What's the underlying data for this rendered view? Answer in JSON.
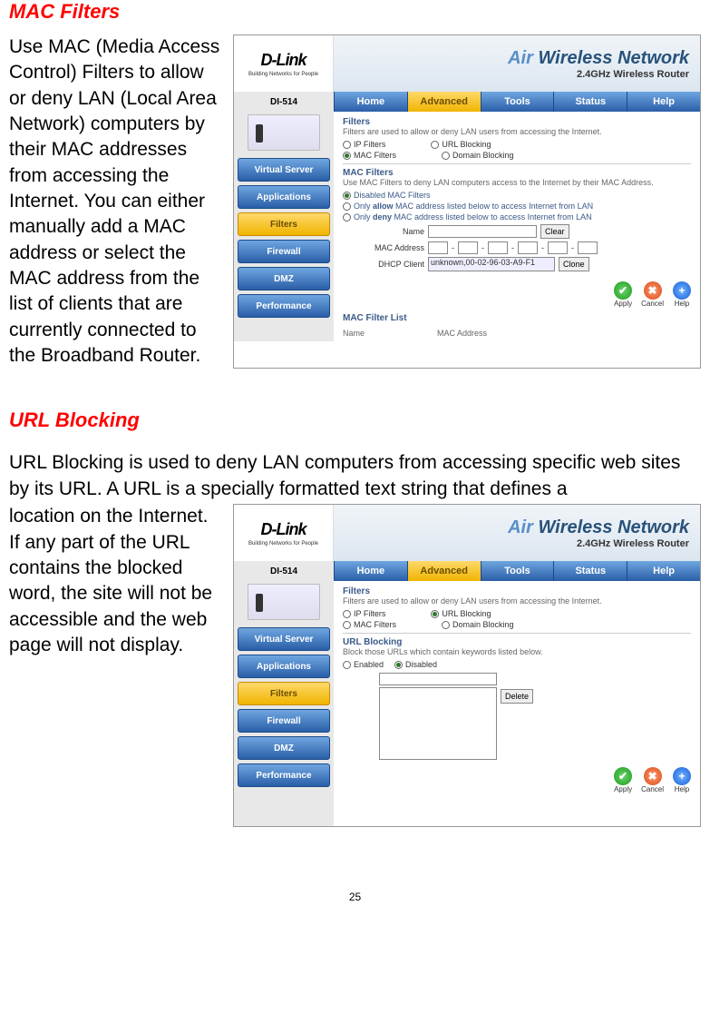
{
  "section1": {
    "heading": "MAC Filters",
    "text": "Use MAC (Media Access Control) Filters to allow or deny LAN (Local Area Network) computers by their MAC addresses from accessing the Internet. You can either manually add a MAC address or select the MAC address from the list of clients that are currently connected to the Broadband Router."
  },
  "section2": {
    "heading": "URL Blocking",
    "intro": "URL Blocking is used to deny LAN computers from accessing specific web sites by its URL. A URL is a specially formatted text string that defines a",
    "text": "location on the Internet. If any part of the URL contains the blocked word, the site will not be accessible and the web page will not display."
  },
  "ui_common": {
    "brand_bold": "D-Link",
    "brand_sub": "Building Networks for People",
    "air": "Air",
    "wireless": " Wireless Network",
    "subbrand": "2.4GHz Wireless Router",
    "model": "DI-514",
    "tabs": {
      "home": "Home",
      "advanced": "Advanced",
      "tools": "Tools",
      "status": "Status",
      "help": "Help"
    },
    "side": {
      "vs": "Virtual Server",
      "app": "Applications",
      "filters": "Filters",
      "firewall": "Firewall",
      "dmz": "DMZ",
      "perf": "Performance"
    },
    "filters_h": "Filters",
    "filters_desc": "Filters are used to allow or deny LAN users from accessing the Internet.",
    "opt_ip": "IP Filters",
    "opt_url": "URL Blocking",
    "opt_mac": "MAC Filters",
    "opt_domain": "Domain Blocking",
    "actions": {
      "apply": "Apply",
      "cancel": "Cancel",
      "help": "Help"
    }
  },
  "mac_pane": {
    "h": "MAC Filters",
    "desc": "Use MAC Filters to deny LAN computers access to the Internet by their MAC Address.",
    "r1": "Disabled MAC Filters",
    "r2_a": "Only ",
    "r2_b": "allow",
    "r2_c": " MAC address listed below to access Internet from LAN",
    "r3_a": "Only ",
    "r3_b": "deny",
    "r3_c": " MAC address listed below to access Internet from LAN",
    "lbl_name": "Name",
    "lbl_mac": "MAC Address",
    "lbl_dhcp": "DHCP Client",
    "dhcp_val": "unknown,00-02-96-03-A9-F1",
    "btn_clear": "Clear",
    "btn_clone": "Clone",
    "list_h": "MAC Filter List",
    "col1": "Name",
    "col2": "MAC Address"
  },
  "url_pane": {
    "h": "URL Blocking",
    "desc": "Block those URLs which contain keywords listed below.",
    "r_en": "Enabled",
    "r_dis": "Disabled",
    "btn_del": "Delete"
  },
  "page_number": "25"
}
